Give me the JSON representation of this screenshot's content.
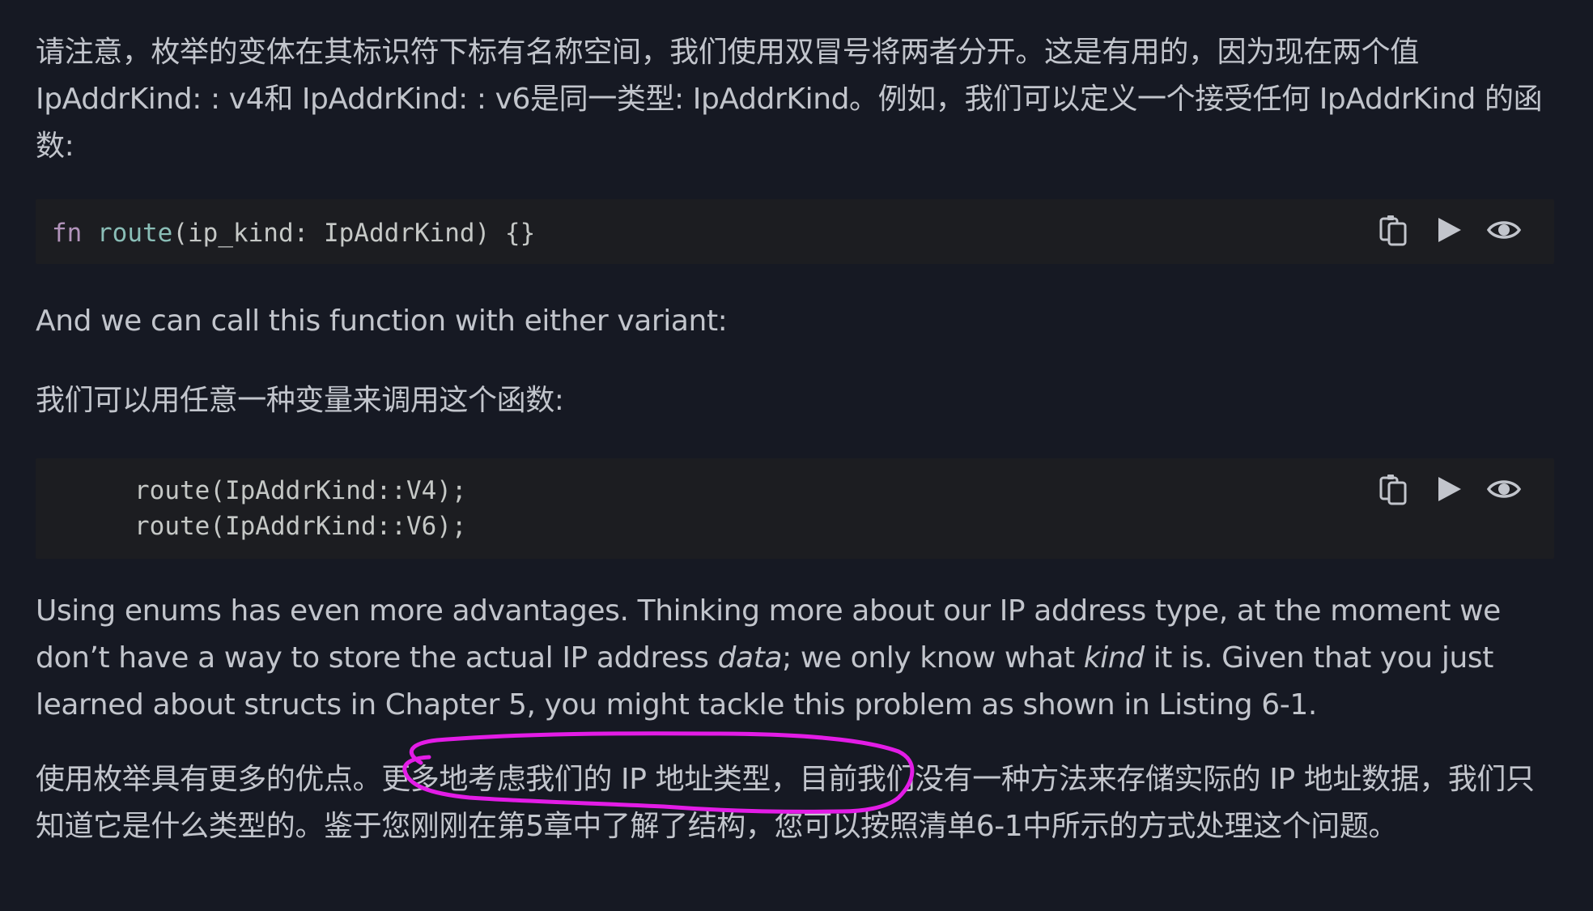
{
  "paragraphs": {
    "p1": "请注意，枚举的变体在其标识符下标有名称空间，我们使用双冒号将两者分开。这是有用的，因为现在两个值 IpAddrKind: : v4和 IpAddrKind: : v6是同一类型: IpAddrKind。例如，我们可以定义一个接受任何 IpAddrKind 的函数:",
    "p2": "And we can call this function with either variant:",
    "p3": "我们可以用任意一种变量来调用这个函数:",
    "p4_part1": "Using enums has even more advantages. Thinking more about our IP address type, at the moment we don’t have a way to store the actual IP address ",
    "p4_em1": "data",
    "p4_part2": "; we only know what ",
    "p4_em2": "kind",
    "p4_part3": " it is. Given that you just learned about structs in Chapter 5, you might tackle this problem as shown in Listing 6-1.",
    "p5": "使用枚举具有更多的优点。更多地考虑我们的 IP 地址类型，目前我们没有一种方法来存储实际的 IP 地址数据，我们只知道它是什么类型的。鉴于您刚刚在第5章中了解了结构，您可以按照清单6-1中所示的方式处理这个问题。"
  },
  "code1": {
    "keyword": "fn",
    "fn_name": "route",
    "rest": "(ip_kind: IpAddrKind) {}"
  },
  "code2": {
    "lines": [
      "route(IpAddrKind::V4);",
      "route(IpAddrKind::V6);"
    ]
  },
  "icons": [
    "copy-icon",
    "play-icon",
    "eye-icon"
  ],
  "colors": {
    "background": "#161923",
    "text": "#c2c5cc",
    "code_bg": "#1c1d21",
    "keyword": "#b294bb",
    "function": "#8abeb7",
    "annotation": "#e31ce6"
  }
}
